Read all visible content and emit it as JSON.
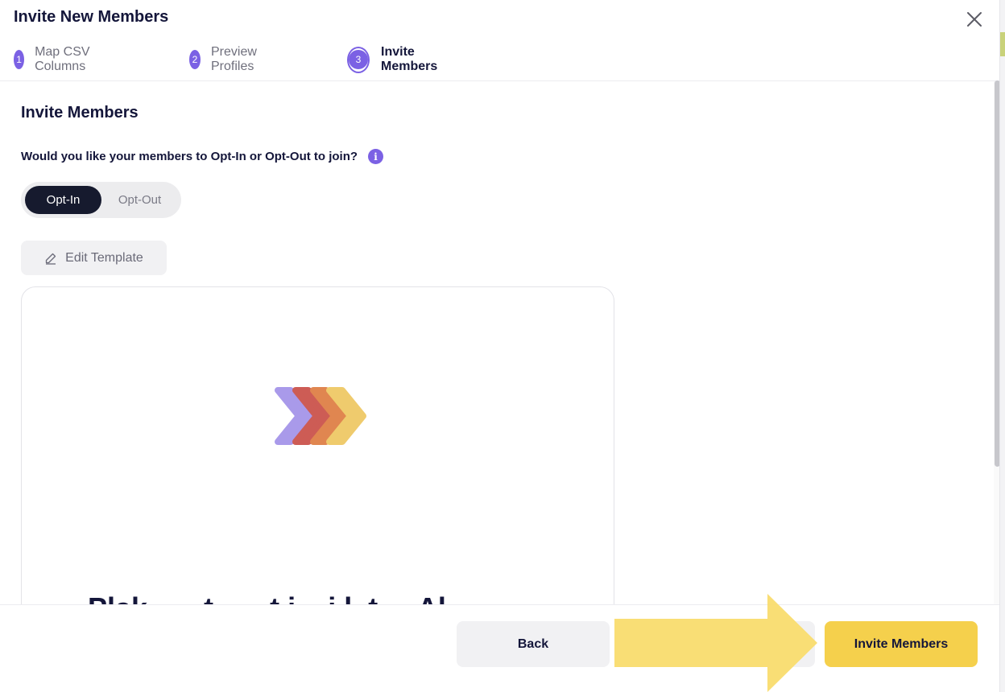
{
  "header": {
    "title": "Invite New Members",
    "steps": [
      {
        "number": "1",
        "label": "Map CSV Columns"
      },
      {
        "number": "2",
        "label": "Preview Profiles"
      },
      {
        "number": "3",
        "label": "Invite Members"
      }
    ],
    "active_step": 3
  },
  "main": {
    "section_title": "Invite Members",
    "question": "Would you like your members to Opt-In or Opt-Out to join?",
    "toggle": {
      "options": [
        "Opt-In",
        "Opt-Out"
      ],
      "selected": "Opt-In"
    },
    "edit_template_label": "Edit Template",
    "preview_heading": "Plak ___t ___t i__i l_t__ Al"
  },
  "footer": {
    "back_label": "Back",
    "invite_label": "Invite Members"
  },
  "colors": {
    "accent_purple": "#7b61e4",
    "navy": "#14163a",
    "primary_yellow": "#f5d04c",
    "arrow_yellow": "#f9dc6e"
  }
}
